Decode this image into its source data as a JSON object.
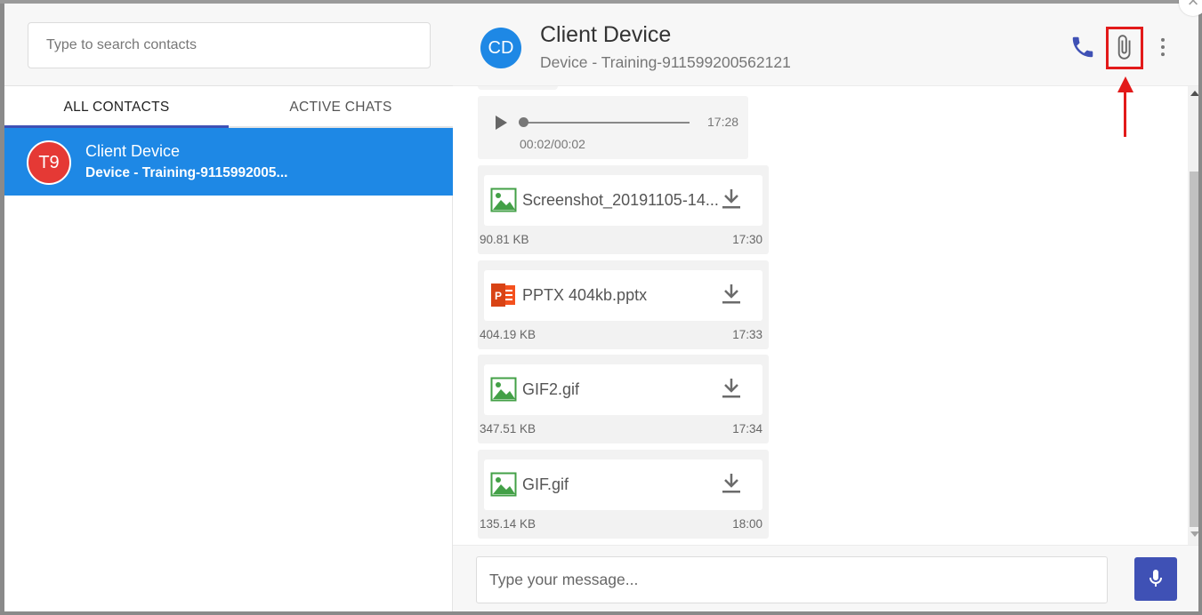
{
  "search": {
    "placeholder": "Type to search contacts"
  },
  "tabs": [
    {
      "label": "ALL CONTACTS"
    },
    {
      "label": "ACTIVE CHATS"
    }
  ],
  "contacts": [
    {
      "avatar": "T9",
      "name": "Client Device",
      "subtitle": "Device - Training-9115992005..."
    }
  ],
  "chat": {
    "avatar": "CD",
    "title": "Client Device",
    "subtitle": "Device - Training-911599200562121",
    "header_icons": [
      "phone-icon",
      "attach-icon",
      "more-vert-icon"
    ]
  },
  "audio": {
    "time": "17:28",
    "progress": "00:02/00:02",
    "position": 0
  },
  "files": [
    {
      "icon": "image-icon",
      "name": "Screenshot_20191105-14...",
      "size": "90.81 KB",
      "time": "17:30"
    },
    {
      "icon": "powerpoint-icon",
      "name": "PPTX 404kb.pptx",
      "size": "404.19 KB",
      "time": "17:33"
    },
    {
      "icon": "image-icon",
      "name": "GIF2.gif",
      "size": "347.51 KB",
      "time": "17:34"
    },
    {
      "icon": "image-icon",
      "name": "GIF.gif",
      "size": "135.14 KB",
      "time": "18:00"
    }
  ],
  "composer": {
    "placeholder": "Type your message..."
  },
  "colors": {
    "accent": "#3f51b5",
    "selected_contact": "#1e88e5",
    "avatar_t9": "#e53935",
    "highlight": "#e21a1a"
  }
}
